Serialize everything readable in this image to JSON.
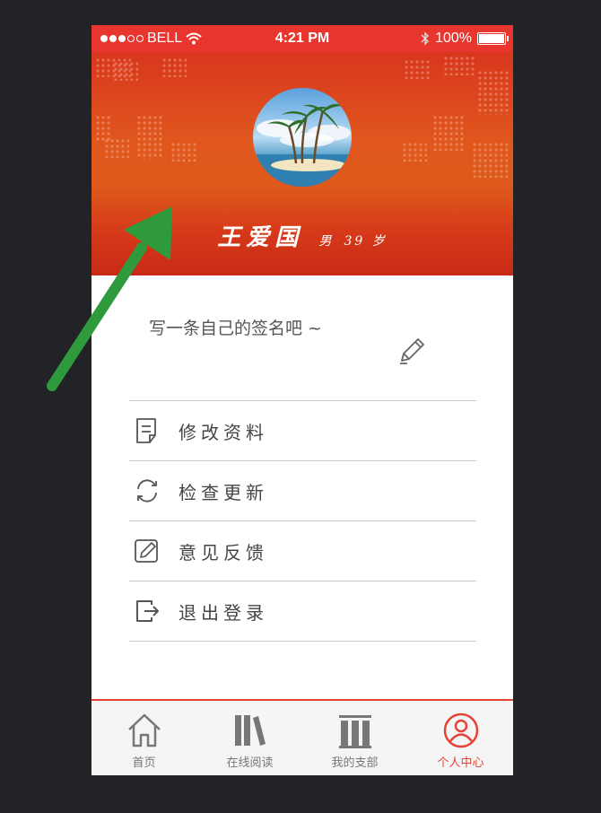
{
  "status_bar": {
    "carrier": "BELL",
    "time": "4:21 PM",
    "battery": "100%",
    "battery_level": 1.0
  },
  "profile": {
    "name": "王爱国",
    "gender": "男",
    "age": "39 岁"
  },
  "signature": {
    "placeholder": "写一条自己的签名吧 ~"
  },
  "menu": [
    {
      "label": "修改资料",
      "icon": "document-icon"
    },
    {
      "label": "检查更新",
      "icon": "refresh-icon"
    },
    {
      "label": "意见反馈",
      "icon": "feedback-pencil-icon"
    },
    {
      "label": "退出登录",
      "icon": "logout-icon"
    }
  ],
  "tabbar": {
    "active_index": 3,
    "tabs": [
      {
        "label": "首页",
        "icon": "home-icon"
      },
      {
        "label": "在线阅读",
        "icon": "books-icon"
      },
      {
        "label": "我的支部",
        "icon": "building-icon"
      },
      {
        "label": "个人中心",
        "icon": "user-icon"
      }
    ]
  },
  "colors": {
    "accent": "#e54335",
    "header_red": "#d8361d",
    "annotation_arrow": "#2e9a3c"
  }
}
